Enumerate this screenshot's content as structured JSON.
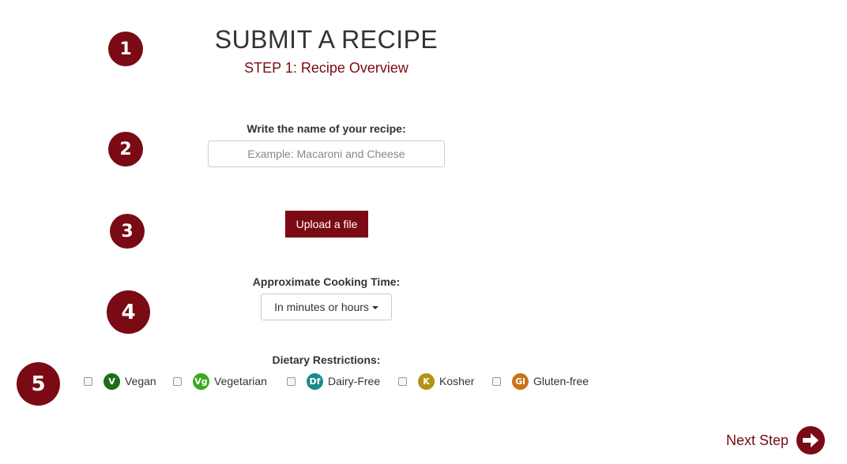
{
  "page": {
    "title": "SUBMIT A RECIPE",
    "subtitle": "STEP 1: Recipe Overview"
  },
  "step_badges": [
    "1",
    "2",
    "3",
    "4",
    "5"
  ],
  "recipe_name": {
    "label": "Write the name of your recipe:",
    "value": "",
    "placeholder": "Example: Macaroni and Cheese"
  },
  "upload": {
    "label": "Upload a file"
  },
  "cooking_time": {
    "label": "Approximate Cooking Time:",
    "selected": "In minutes or hours"
  },
  "dietary": {
    "label": "Dietary Restrictions:",
    "options": [
      {
        "icon_text": "V",
        "label": "Vegan",
        "color": "#1e6e17",
        "checked": false
      },
      {
        "icon_text": "Vg",
        "label": "Vegetarian",
        "color": "#3aaa24",
        "checked": false
      },
      {
        "icon_text": "Df",
        "label": "Dairy-Free",
        "color": "#1b8a8a",
        "checked": false
      },
      {
        "icon_text": "K",
        "label": "Kosher",
        "color": "#b39314",
        "checked": false
      },
      {
        "icon_text": "Gl",
        "label": "Gluten-free",
        "color": "#c97318",
        "checked": false
      }
    ]
  },
  "next_step": {
    "label": "Next Step",
    "icon": "arrow-right-circle-icon"
  },
  "colors": {
    "accent": "#7a0a14"
  }
}
